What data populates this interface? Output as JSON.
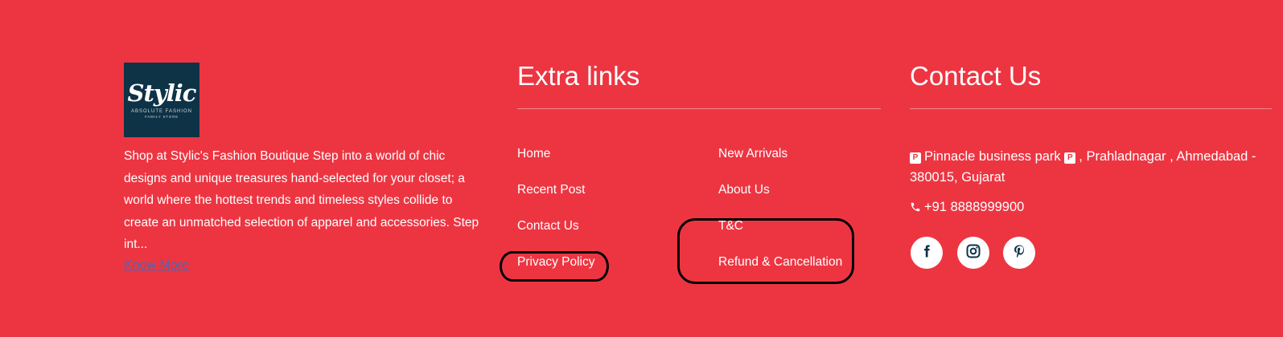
{
  "logo": {
    "wordmark": "Stylic",
    "tagline": "ABSOLUTE FASHION",
    "subtagline": "FAMILY STORE",
    "bg_color": "#0e3246"
  },
  "about": {
    "text": "Shop at Stylic's Fashion Boutique Step into a world of chic designs and unique treasures hand-selected for your closet; a world where the hottest trends and timeless styles collide to create an unmatched selection of apparel and accessories. Step int...",
    "know_more": "Know More"
  },
  "extra_links": {
    "heading": "Extra links",
    "left": [
      "Home",
      "Recent Post",
      "Contact Us",
      "Privacy Policy"
    ],
    "right": [
      "New Arrivals",
      "About Us",
      "T&C",
      "Refund & Cancellation"
    ]
  },
  "contact": {
    "heading": "Contact Us",
    "pin_glyph": "P",
    "address_part1": "Pinnacle business park",
    "address_part2": ", Prahladnagar , Ahmedabad -",
    "address_line2": "380015, Gujarat",
    "phone": "+91 8888999900",
    "social": [
      "facebook-icon",
      "instagram-icon",
      "pinterest-icon"
    ]
  },
  "colors": {
    "background": "#ed3542",
    "text": "#ffffff",
    "link_blue": "#4d67b0",
    "icon_navy": "#0e3246",
    "annotation": "#000000"
  }
}
